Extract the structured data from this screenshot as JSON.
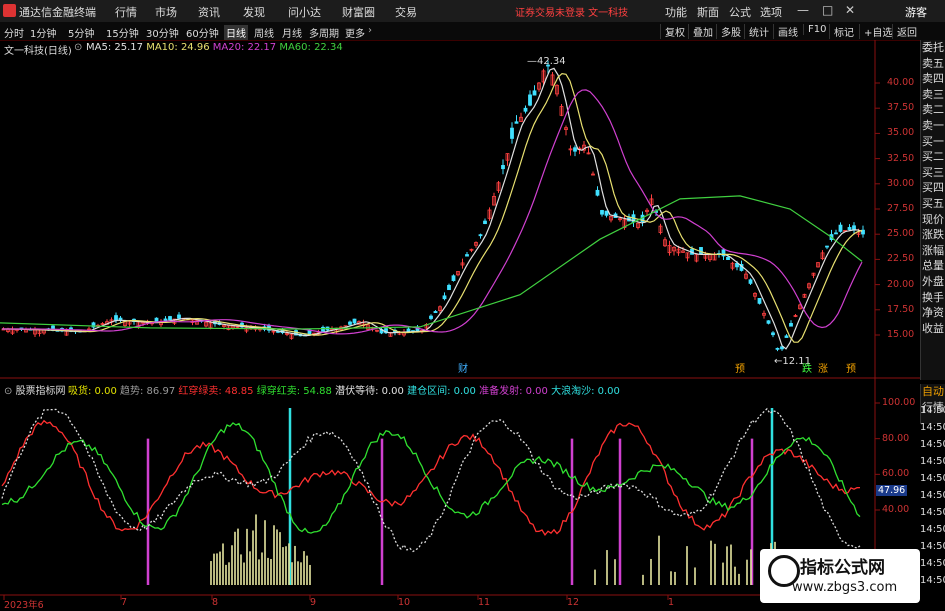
{
  "app": {
    "title": "通达信金融终端",
    "menu": [
      "行情",
      "市场",
      "资讯",
      "发现",
      "问小达",
      "财富圈",
      "交易"
    ],
    "notice": "证券交易未登录  文一科技",
    "right_menu": [
      "功能",
      "斯面",
      "公式",
      "选项"
    ],
    "guest": "游客",
    "window_controls": [
      "—",
      "□",
      "✕"
    ]
  },
  "toolbar": {
    "timeframes": [
      "分时",
      "1分钟",
      "5分钟",
      "15分钟",
      "30分钟",
      "60分钟",
      "日线",
      "周线",
      "月线",
      "多周期",
      "更多"
    ],
    "active_timeframe": "日线",
    "right_buttons": [
      "复权",
      "叠加",
      "多股",
      "统计",
      "画线",
      "F10",
      "标记",
      "+自选",
      "返回"
    ]
  },
  "sidebar": [
    "委托",
    "卖五",
    "卖四",
    "卖三",
    "卖二",
    "卖一",
    "买一",
    "买二",
    "买三",
    "买四",
    "买五",
    "现价",
    "涨跌",
    "涨幅",
    "总量",
    "外盘",
    "换手",
    "净资",
    "收益"
  ],
  "sidebar2": [
    "自动",
    "行情"
  ],
  "main_chart": {
    "stock_label": "文一科技(日线)",
    "ma": [
      {
        "name": "MA5",
        "value": "25.17",
        "color": "#e0e0e0"
      },
      {
        "name": "MA10",
        "value": "24.96",
        "color": "#e8e070"
      },
      {
        "name": "MA20",
        "value": "22.17",
        "color": "#d040d0"
      },
      {
        "name": "MA60",
        "value": "22.34",
        "color": "#40d040"
      }
    ],
    "y_ticks": [
      "40.00",
      "37.50",
      "35.00",
      "32.50",
      "30.00",
      "27.50",
      "25.00",
      "22.50",
      "20.00",
      "17.50",
      "15.00"
    ],
    "high_label": "42.34",
    "low_label": "12.11",
    "markers": [
      {
        "text": "财",
        "color": "#40b0ff"
      },
      {
        "text": "预",
        "color": "#f0a000"
      },
      {
        "text": "跌",
        "color": "#40ff40"
      },
      {
        "text": "涨",
        "color": "#f0a000"
      },
      {
        "text": "预",
        "color": "#f0a000"
      }
    ]
  },
  "indicator": {
    "name": "股票指标网",
    "values": [
      {
        "label": "吸货: 0.00",
        "color": "#e0e000"
      },
      {
        "label": "趋势: 86.97",
        "color": "#999999"
      },
      {
        "label": "红穿绿卖: 48.85",
        "color": "#ff3030"
      },
      {
        "label": "绿穿红卖: 54.88",
        "color": "#30e030"
      },
      {
        "label": "潜伏等待: 0.00",
        "color": "#e0e0e0"
      },
      {
        "label": "建仓区间: 0.00",
        "color": "#30e0e0"
      },
      {
        "label": "准备发射: 0.00",
        "color": "#d040d0"
      },
      {
        "label": "大浪淘沙: 0.00",
        "color": "#30e0e0"
      }
    ],
    "y_ticks": [
      "100.00",
      "80.00",
      "60.00",
      "40.00"
    ],
    "current_value": "47.96",
    "right_times": [
      "14:50",
      "14:50",
      "14:50",
      "14:50",
      "14:50",
      "14:50",
      "14:50",
      "14:50",
      "14:50",
      "14:50",
      "14:50"
    ]
  },
  "x_axis": [
    "2023年6",
    "7",
    "8",
    "9",
    "10",
    "11",
    "12",
    "1"
  ],
  "watermark": {
    "title": "指标公式网",
    "url": "www.zbgs3.com"
  }
}
